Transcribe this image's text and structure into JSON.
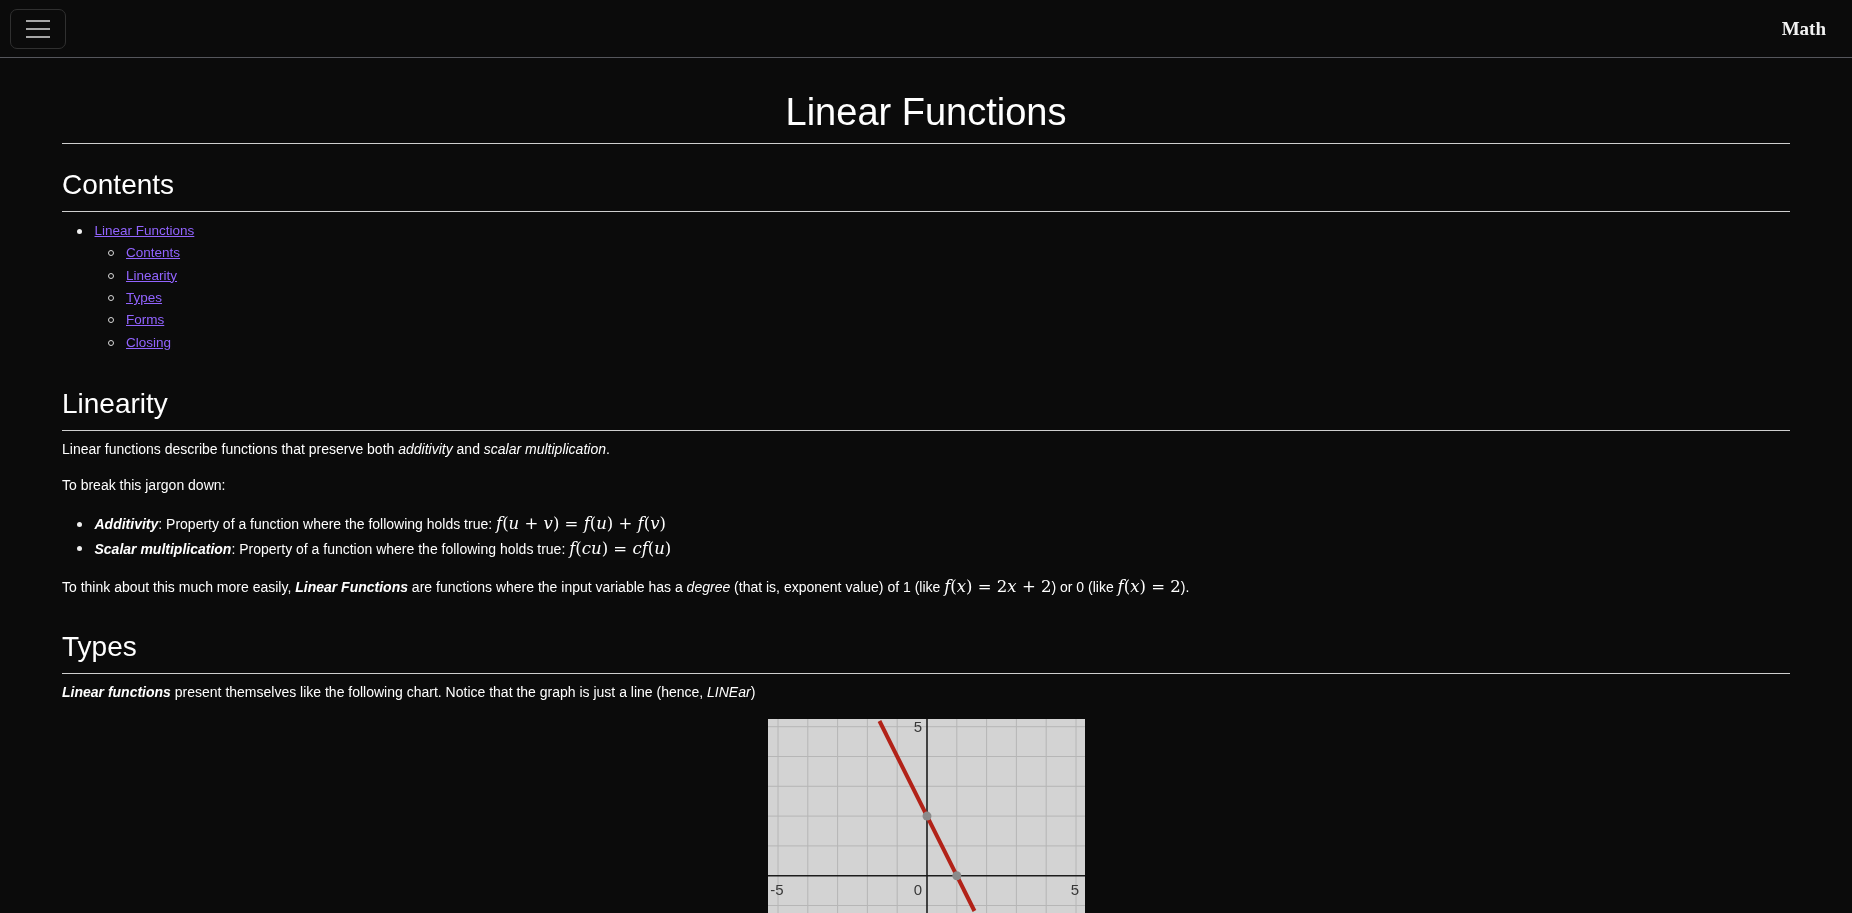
{
  "navbar": {
    "brand": "Math"
  },
  "title": "Linear Functions",
  "sections": [
    {
      "heading": "Contents",
      "toc": [
        {
          "label": "Linear Functions",
          "children": [
            {
              "label": "Contents"
            },
            {
              "label": "Linearity"
            },
            {
              "label": "Types"
            },
            {
              "label": "Forms"
            },
            {
              "label": "Closing"
            }
          ]
        }
      ]
    },
    {
      "heading": "Linearity",
      "blocks": [
        {
          "kind": "paragraph",
          "segments": [
            {
              "kind": "plain",
              "text": "Linear functions describe functions that preserve both "
            },
            {
              "kind": "italic",
              "text": "additivity"
            },
            {
              "kind": "plain",
              "text": " and "
            },
            {
              "kind": "italic",
              "text": "scalar multiplication"
            },
            {
              "kind": "plain",
              "text": "."
            }
          ]
        },
        {
          "kind": "paragraph",
          "segments": [
            {
              "kind": "plain",
              "text": "To break this jargon down:"
            }
          ]
        },
        {
          "kind": "list",
          "items": [
            {
              "segments": [
                {
                  "kind": "bolditalic",
                  "text": "Additivity"
                },
                {
                  "kind": "plain",
                  "text": ": Property of a function where the following holds true: "
                },
                {
                  "kind": "math",
                  "text": "f(u + v) = f(u) + f(v)"
                }
              ]
            },
            {
              "segments": [
                {
                  "kind": "bolditalic",
                  "text": "Scalar multiplication"
                },
                {
                  "kind": "plain",
                  "text": ": Property of a function where the following holds true: "
                },
                {
                  "kind": "math",
                  "text": "f(cu) = cf(u)"
                }
              ]
            }
          ]
        },
        {
          "kind": "paragraph",
          "segments": [
            {
              "kind": "plain",
              "text": "To think about this much more easily, "
            },
            {
              "kind": "bolditalic",
              "text": "Linear Functions"
            },
            {
              "kind": "plain",
              "text": " are functions where the input variable has a "
            },
            {
              "kind": "italic",
              "text": "degree"
            },
            {
              "kind": "plain",
              "text": " (that is, exponent value) of 1 (like "
            },
            {
              "kind": "math",
              "text": "f(x) = 2x + 2"
            },
            {
              "kind": "plain",
              "text": ") or 0 (like "
            },
            {
              "kind": "math",
              "text": "f(x) = 2"
            },
            {
              "kind": "plain",
              "text": ")."
            }
          ]
        }
      ]
    },
    {
      "heading": "Types",
      "blocks": [
        {
          "kind": "paragraph",
          "segments": [
            {
              "kind": "bolditalic",
              "text": "Linear functions"
            },
            {
              "kind": "plain",
              "text": " present themselves like the following chart. Notice that the graph is just a line (hence, "
            },
            {
              "kind": "italic",
              "text": "LINEar"
            },
            {
              "kind": "plain",
              "text": ")"
            }
          ]
        },
        {
          "kind": "graph",
          "tick_labels": [
            {
              "kind": "ytick",
              "text": "5"
            },
            {
              "kind": "xtick",
              "text": "-5"
            },
            {
              "kind": "origin",
              "text": "0"
            },
            {
              "kind": "xtick",
              "text": "5"
            }
          ]
        }
      ]
    }
  ]
}
